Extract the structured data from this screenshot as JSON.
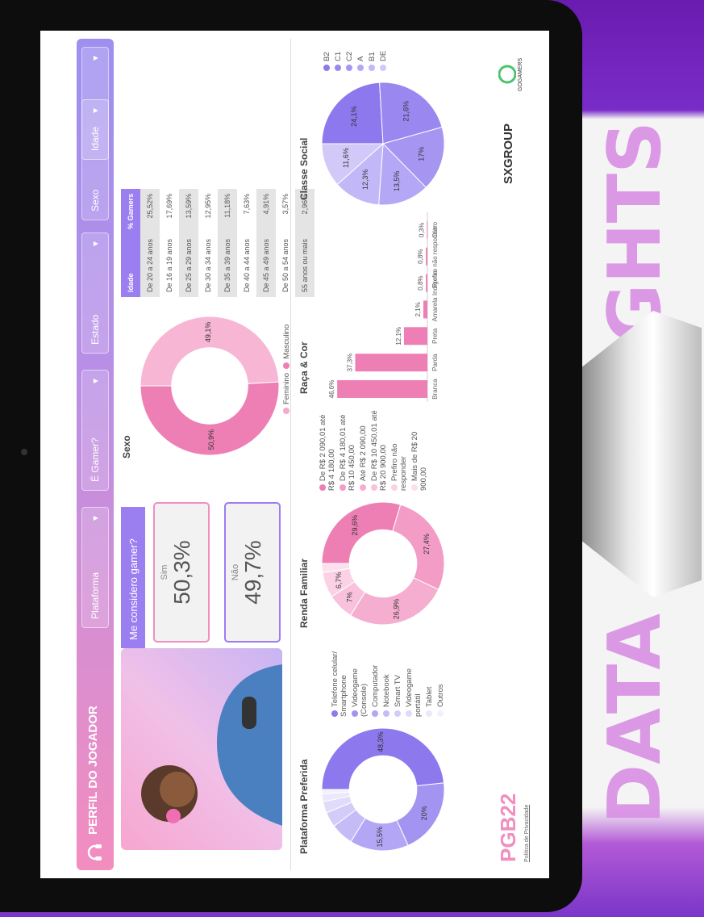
{
  "background": {
    "text_vertical": "DATA",
    "text_vertical_2": "INSIGHTS"
  },
  "header": {
    "title": "PERFIL DO JOGADOR"
  },
  "filters": [
    {
      "label": "Plataforma"
    },
    {
      "label": "É Gamer?"
    },
    {
      "label": "Estado"
    },
    {
      "label": "Sexo"
    },
    {
      "label": "Idade"
    }
  ],
  "gamer": {
    "title": "Me considero gamer?",
    "sim_label": "Sim",
    "sim_value": "50,3%",
    "nao_label": "Não",
    "nao_value": "49,7%"
  },
  "sexo": {
    "title": "Sexo",
    "chart_data": {
      "type": "pie",
      "categories": [
        "Feminino",
        "Masculino"
      ],
      "values": [
        49.1,
        50.9
      ],
      "value_labels": [
        "49,1%",
        "50,9%"
      ]
    }
  },
  "idade": {
    "col1": "Idade",
    "col2": "% Gamers",
    "rows": [
      [
        "De 20 a 24 anos",
        "25,52%"
      ],
      [
        "De 16 a 19 anos",
        "17,69%"
      ],
      [
        "De 25 a 29 anos",
        "13,59%"
      ],
      [
        "De 30 a 34 anos",
        "12,95%"
      ],
      [
        "De 35 a 39 anos",
        "11,18%"
      ],
      [
        "De 40 a 44 anos",
        "7,63%"
      ],
      [
        "De 45 a 49 anos",
        "4,91%"
      ],
      [
        "De 50 a 54 anos",
        "3,57%"
      ],
      [
        "55 anos ou mais",
        "2,96%"
      ]
    ]
  },
  "plataforma": {
    "title": "Plataforma Preferida",
    "chart_data": {
      "type": "pie",
      "categories": [
        "Telefone celular/ Smartphone",
        "Videogame (Console)",
        "Computador",
        "Notebook",
        "Smart TV",
        "Videogame portátil",
        "Tablet",
        "Outros"
      ],
      "values": [
        48.3,
        20,
        15.5,
        6,
        4,
        3,
        2,
        1.2
      ],
      "value_labels": [
        "48,3%",
        "20%",
        "15,5%",
        "",
        "",
        "",
        "",
        ""
      ]
    }
  },
  "renda": {
    "title": "Renda Familiar",
    "chart_data": {
      "type": "pie",
      "categories": [
        "De R$ 2 090,01 até R$ 4 180,00",
        "De R$ 4 180,01 até R$ 10 450,00",
        "Até R$ 2 090,00",
        "De R$ 10 450,01 até R$ 20 900,00",
        "Prefiro não responder",
        "Mais de R$ 20 900,00"
      ],
      "values": [
        29.6,
        27.4,
        26.9,
        7,
        6.7,
        2.4
      ],
      "value_labels": [
        "29,6%",
        "27,4%",
        "26,9%",
        "7%",
        "6,7%",
        ""
      ]
    }
  },
  "raca": {
    "title": "Raça & Cor",
    "chart_data": {
      "type": "bar",
      "categories": [
        "Branca",
        "Parda",
        "Preta",
        "Amarela",
        "Indígena",
        "Prefiro não responder",
        "Outro"
      ],
      "values": [
        46.6,
        37.3,
        12.1,
        2.1,
        0.8,
        0.8,
        0.3
      ],
      "value_labels": [
        "46,6%",
        "37,3%",
        "12,1%",
        "2,1%",
        "0,8%",
        "0,8%",
        "0,3%"
      ]
    }
  },
  "classe": {
    "title": "Classe Social",
    "chart_data": {
      "type": "pie",
      "categories": [
        "B2",
        "C1",
        "C2",
        "A",
        "B1",
        "DE"
      ],
      "values": [
        24.1,
        21.6,
        17,
        13.5,
        12.3,
        11.6
      ],
      "value_labels": [
        "24,1%",
        "21,6%",
        "17%",
        "13,5%",
        "12,3%",
        "11,6%"
      ]
    }
  },
  "footer": {
    "pgb": "PGB22",
    "privacy": "Política de Privacidade",
    "sx": "SXGROUP",
    "go": "GOGAMERS"
  },
  "colors": {
    "purple": "#8d78ee",
    "pink": "#ee7fb5",
    "lightpink": "#f7c6de"
  }
}
